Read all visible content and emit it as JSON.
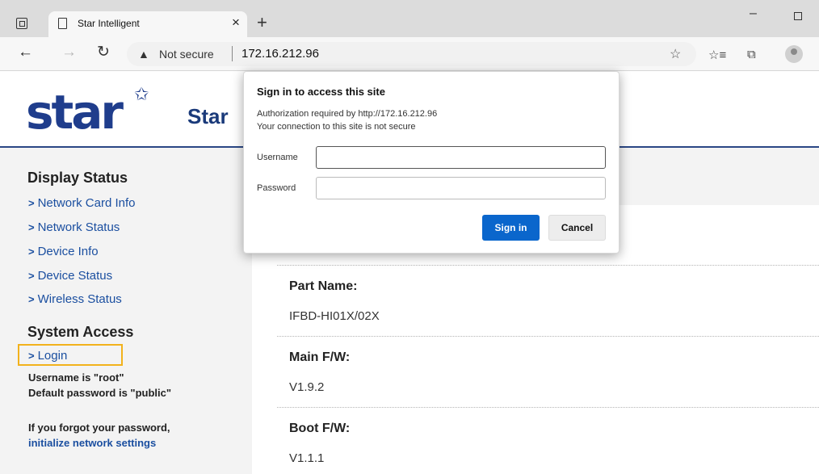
{
  "browser": {
    "tab_title": "Star Intelligent",
    "tab_close": "×",
    "new_tab": "+",
    "minimize": "–",
    "address": {
      "security_label": "Not secure",
      "url": "172.16.212.96"
    },
    "icons": {
      "tab_actions": "tab-actions-icon",
      "back": "back-arrow-icon",
      "forward": "forward-arrow-icon",
      "reload": "reload-icon",
      "warning": "warning-icon",
      "add_favorite": "add-favorite-icon",
      "favorites": "favorites-icon",
      "collections": "collections-icon",
      "profile": "profile-icon"
    }
  },
  "page": {
    "brand": "Star",
    "logo_text": "star",
    "sidebar": {
      "display_status_heading": "Display Status",
      "display_links": [
        "Network Card Info",
        "Network Status",
        "Device Info",
        "Device Status",
        "Wireless Status"
      ],
      "system_access_heading": "System Access",
      "login_link": "Login",
      "username_note": "Username is \"root\"",
      "password_note": "Default password is \"public\"",
      "forgot_note": "If you forgot your password,",
      "forgot_link": "initialize network settings"
    },
    "content": {
      "items": [
        {
          "label": "Part Name:",
          "value": "IFBD-HI01X/02X"
        },
        {
          "label": "Main F/W:",
          "value": "V1.9.2"
        },
        {
          "label": "Boot F/W:",
          "value": "V1.1.1"
        }
      ]
    },
    "colors": {
      "brand_blue": "#1f3d8c",
      "link_blue": "#1b4fa0",
      "highlight": "#f2b21c"
    }
  },
  "dialog": {
    "title": "Sign in to access this site",
    "auth_line": "Authorization required by http://172.16.212.96",
    "insecure_line": "Your connection to this site is not secure",
    "username_label": "Username",
    "username_value": "",
    "password_label": "Password",
    "password_value": "",
    "sign_in": "Sign in",
    "cancel": "Cancel",
    "accent": "#0a66cc"
  }
}
